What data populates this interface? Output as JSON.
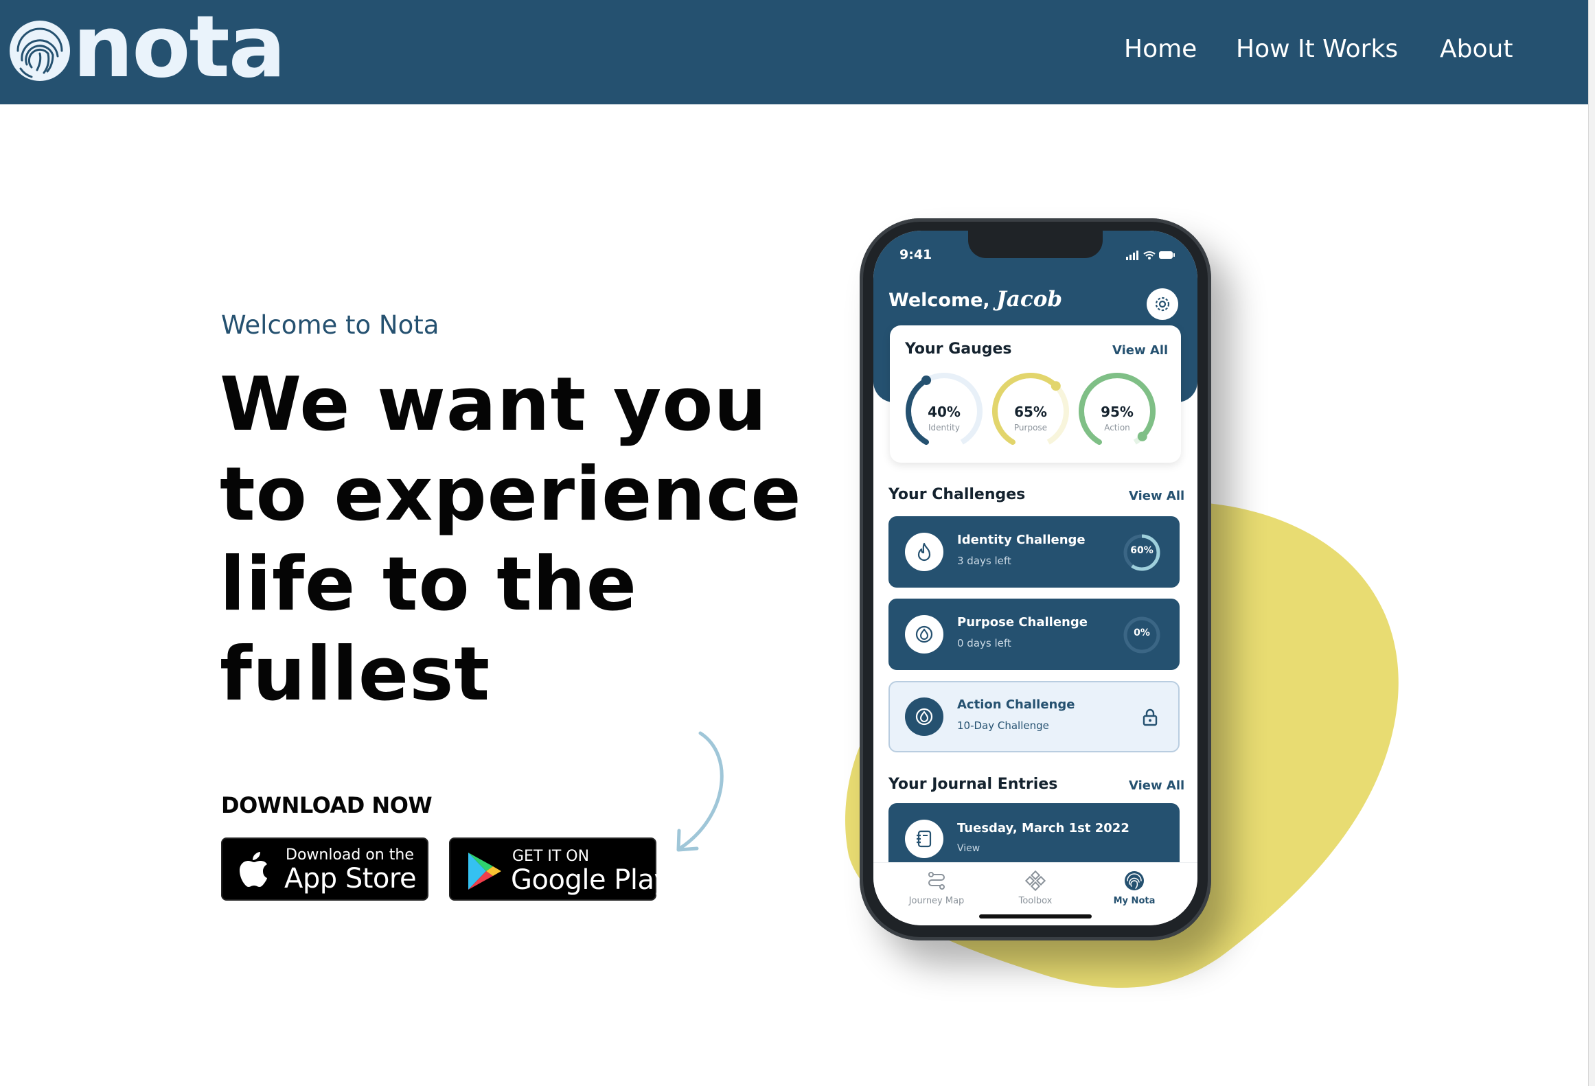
{
  "brand": {
    "name": "nota",
    "logo_icon": "fingerprint-icon"
  },
  "nav": {
    "items": [
      "Home",
      "How It Works",
      "About"
    ]
  },
  "hero": {
    "eyebrow": "Welcome to Nota",
    "headline_lines": [
      "We want you",
      "to experience",
      "life to the",
      "fullest"
    ],
    "download_label": "DOWNLOAD NOW",
    "app_store": {
      "small": "Download on the",
      "big": "App Store",
      "icon": "apple-icon"
    },
    "google_play": {
      "small": "GET IT ON",
      "big": "Google Play",
      "icon": "play-icon"
    }
  },
  "phone": {
    "status_time": "9:41",
    "welcome_prefix": "Welcome,",
    "welcome_name": "Jacob",
    "gauges": {
      "title": "Your Gauges",
      "view_all": "View All",
      "items": [
        {
          "value": "40%",
          "label": "Identity",
          "fraction": 0.4,
          "color": "#255170",
          "track": "#e8f0f8"
        },
        {
          "value": "65%",
          "label": "Purpose",
          "fraction": 0.65,
          "color": "#e2d56c",
          "track": "#f8f5dc"
        },
        {
          "value": "95%",
          "label": "Action",
          "fraction": 0.95,
          "color": "#7fbf86",
          "track": "#e5f3e6"
        }
      ]
    },
    "challenges": {
      "title": "Your Challenges",
      "view_all": "View All",
      "items": [
        {
          "name": "Identity Challenge",
          "sub": "3 days left",
          "status": "60%",
          "icon": "flame-icon"
        },
        {
          "name": "Purpose Challenge",
          "sub": "0 days left",
          "status": "0%",
          "icon": "drop-icon"
        },
        {
          "name": "Action Challenge",
          "sub": "10-Day Challenge",
          "status": "",
          "icon": "drop-icon"
        }
      ]
    },
    "journal": {
      "title": "Your Journal Entries",
      "view_all": "View All",
      "entry_date": "Tuesday, March 1st 2022",
      "entry_sub": "View"
    },
    "tabs": [
      "Journey Map",
      "Toolbox",
      "My Nota"
    ]
  },
  "colors": {
    "navy": "#255170",
    "blob_yellow": "#e8dc72",
    "arrow_blue": "#9fc6d8"
  }
}
